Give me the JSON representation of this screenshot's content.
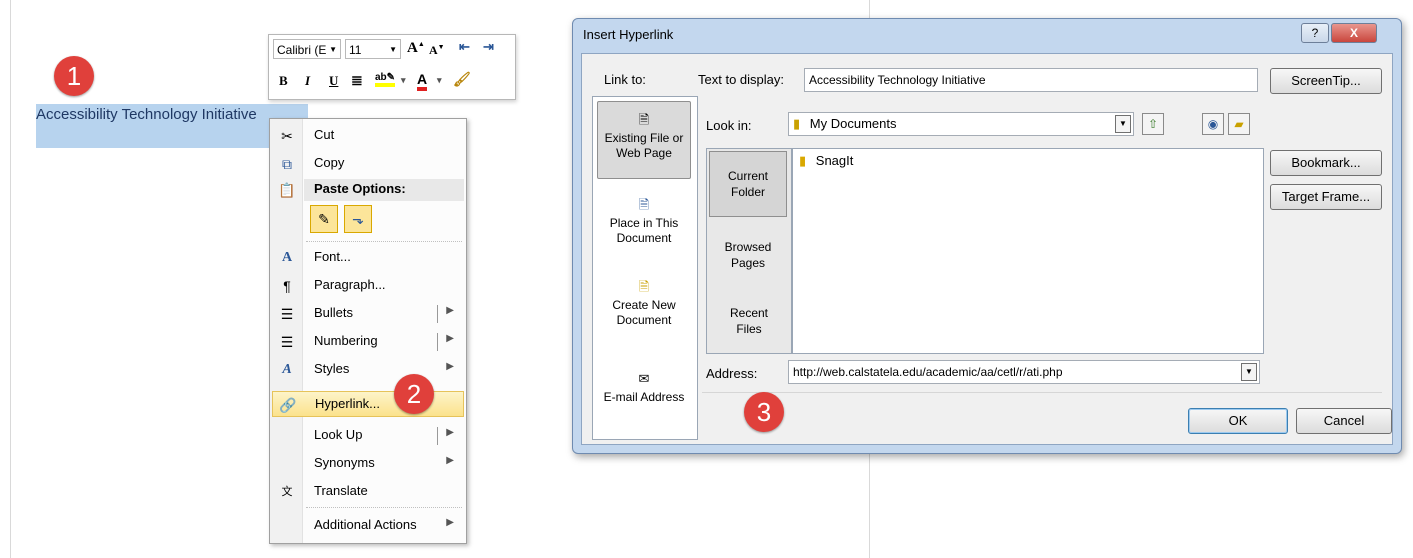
{
  "document": {
    "selected_text": "Accessibility Technology Initiative"
  },
  "badges": [
    "1",
    "2",
    "3"
  ],
  "mini_toolbar": {
    "font_name": "Calibri (E",
    "font_size": "11",
    "grow_font": "A",
    "shrink_font": "A",
    "bold": "B",
    "italic": "I",
    "underline": "U",
    "highlight": "ab",
    "font_color": "A"
  },
  "context_menu": {
    "items": [
      {
        "label": "Cut",
        "icon": "scissors-icon"
      },
      {
        "label": "Copy",
        "icon": "copy-icon"
      },
      {
        "label": "Paste Options:",
        "icon": "paste-icon"
      },
      {
        "label": "Font...",
        "icon": "font-icon"
      },
      {
        "label": "Paragraph...",
        "icon": "paragraph-icon"
      },
      {
        "label": "Bullets",
        "icon": "bullets-icon"
      },
      {
        "label": "Numbering",
        "icon": "numbering-icon"
      },
      {
        "label": "Styles",
        "icon": "styles-icon"
      },
      {
        "label": "Hyperlink...",
        "icon": "hyperlink-icon"
      },
      {
        "label": "Look Up",
        "icon": ""
      },
      {
        "label": "Synonyms",
        "icon": ""
      },
      {
        "label": "Translate",
        "icon": "translate-icon"
      },
      {
        "label": "Additional Actions",
        "icon": ""
      }
    ]
  },
  "dialog": {
    "title": "Insert Hyperlink",
    "help_label": "?",
    "close_label": "X",
    "link_to_label": "Link to:",
    "text_to_display_label": "Text to display:",
    "text_to_display_value": "Accessibility Technology Initiative",
    "screentip_label": "ScreenTip...",
    "look_in_label": "Look in:",
    "look_in_value": "My Documents",
    "link_to_items": [
      "Existing File or Web Page",
      "Place in This Document",
      "Create New Document",
      "E-mail Address"
    ],
    "folder_tabs": [
      "Current Folder",
      "Browsed Pages",
      "Recent Files"
    ],
    "files": [
      "SnagIt"
    ],
    "bookmark_label": "Bookmark...",
    "target_frame_label": "Target Frame...",
    "address_label": "Address:",
    "address_value": "http://web.calstatela.edu/academic/aa/cetl/r/ati.php",
    "ok_label": "OK",
    "cancel_label": "Cancel"
  },
  "colors": {
    "badge": "#e0403b",
    "selection": "#b7d3ee",
    "highlight_item": "#fbe28c",
    "dialog_frame": "#c3d7ee",
    "close_button": "#c9463d"
  }
}
